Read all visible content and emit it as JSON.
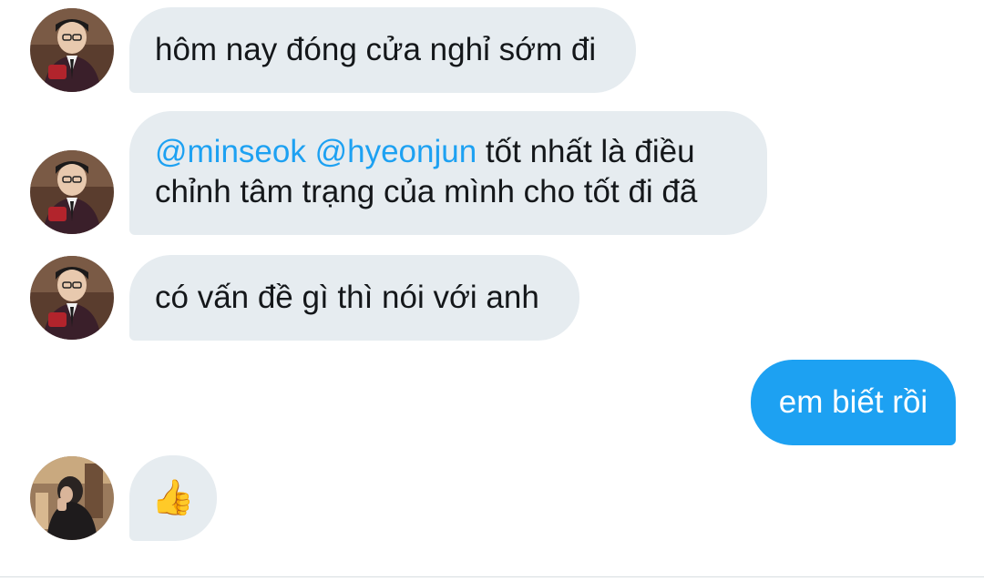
{
  "conversation": {
    "messages": [
      {
        "sender": "other",
        "text": "hôm nay đóng cửa nghỉ sớm đi"
      },
      {
        "sender": "other",
        "mentions": [
          "@minseok",
          "@hyeonjun"
        ],
        "line1_rest": " tốt nhất là điều",
        "line2": "chỉnh tâm trạng của mình cho tốt đi đã"
      },
      {
        "sender": "other",
        "text": "có vấn đề gì thì nói với anh"
      },
      {
        "sender": "me",
        "text": "em biết rồi"
      },
      {
        "sender": "other2",
        "text": "👍"
      }
    ]
  },
  "colors": {
    "incoming_bubble": "#e6ecf0",
    "outgoing_bubble": "#1da1f2",
    "mention": "#1da1f2"
  }
}
